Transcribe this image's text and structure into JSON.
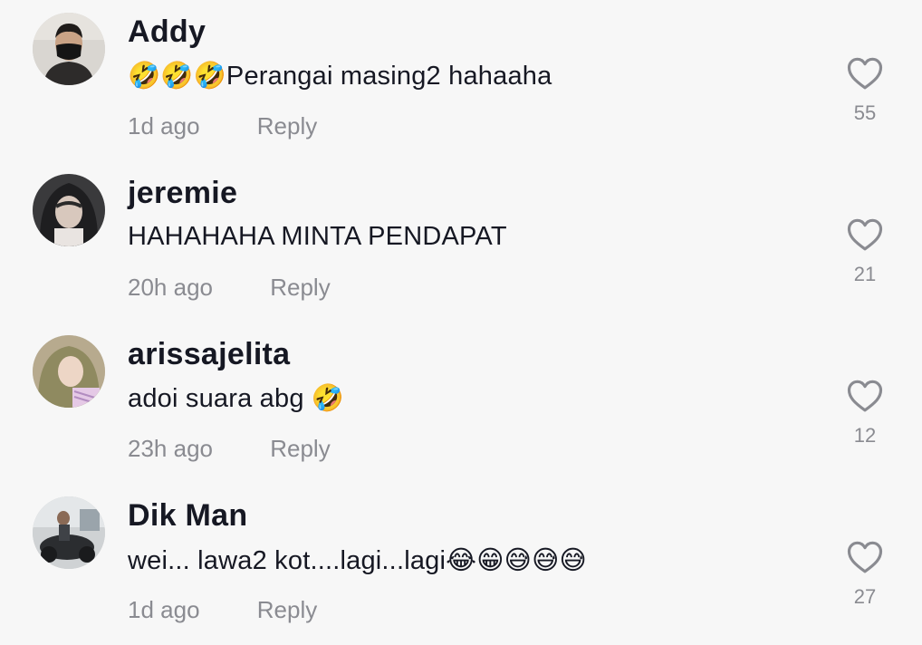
{
  "comments": [
    {
      "username": "Addy",
      "text": "🤣🤣🤣Perangai masing2 hahaaha",
      "time": "1d ago",
      "reply": "Reply",
      "likes": "55",
      "avatar": "avatar-masked-man"
    },
    {
      "username": "jeremie",
      "text": "HAHAHAHA MINTA PENDAPAT",
      "time": "20h ago",
      "reply": "Reply",
      "likes": "21",
      "avatar": "avatar-hooded-person"
    },
    {
      "username": "arissajelita",
      "text": "adoi suara abg 🤣",
      "time": "23h ago",
      "reply": "Reply",
      "likes": "12",
      "avatar": "avatar-hijab-woman"
    },
    {
      "username": "Dik Man",
      "text": "wei... lawa2 kot....lagi...lagi😂😁😅😅😅",
      "time": "1d ago",
      "reply": "Reply",
      "likes": "27",
      "avatar": "avatar-man-motorbike"
    }
  ],
  "icons": {
    "like": "heart-outline-icon"
  },
  "colors": {
    "background": "#f7f7f7",
    "text": "#161823",
    "muted": "#8a8b91"
  }
}
